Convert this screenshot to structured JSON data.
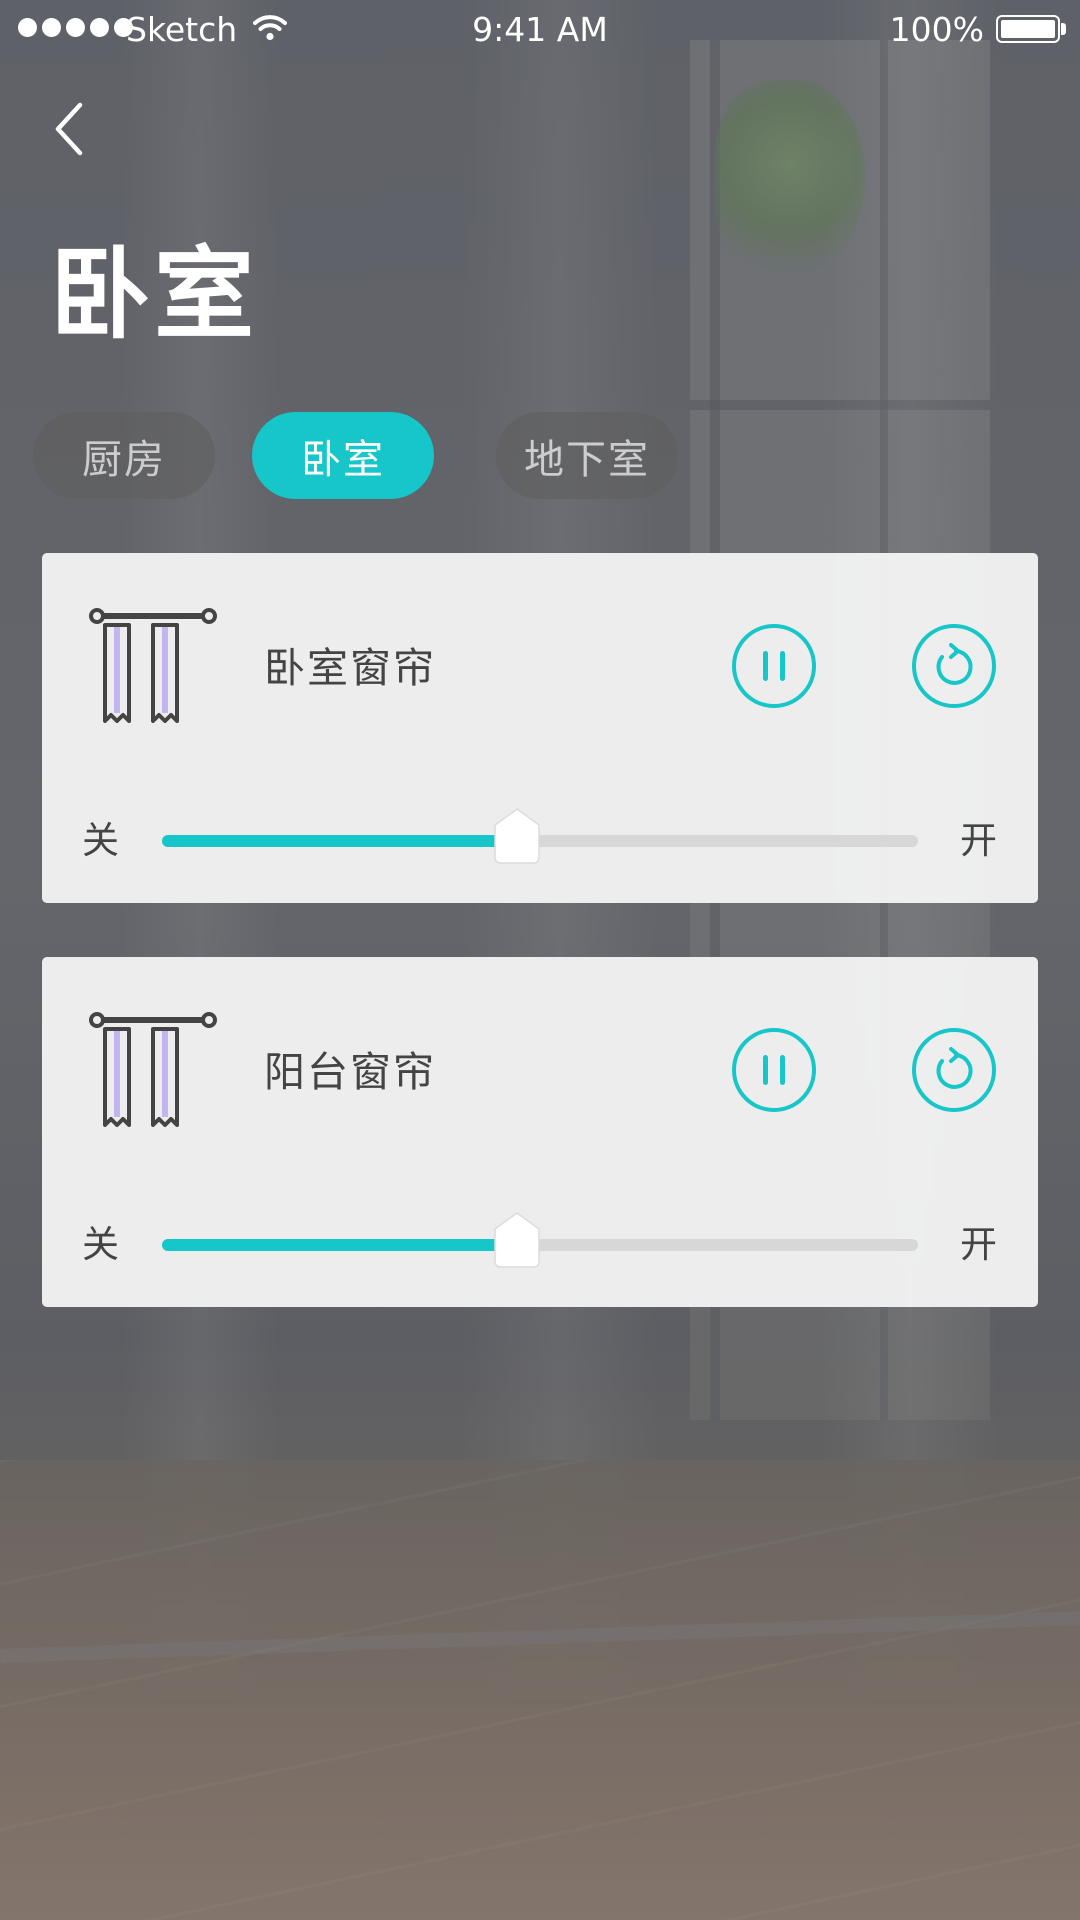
{
  "status_bar": {
    "carrier": "Sketch",
    "time": "9:41 AM",
    "battery": "100%"
  },
  "header": {
    "title": "卧室"
  },
  "tabs": [
    {
      "label": "厨房",
      "active": false
    },
    {
      "label": "卧室",
      "active": true
    },
    {
      "label": "地下室",
      "active": false
    }
  ],
  "devices": [
    {
      "name": "卧室窗帘",
      "icon": "curtain-icon",
      "slider_min": "关",
      "slider_max": "开",
      "level": 0.47
    },
    {
      "name": "阳台窗帘",
      "icon": "curtain-icon",
      "slider_min": "关",
      "slider_max": "开",
      "level": 0.47
    }
  ],
  "controls": {
    "pause_icon": "pause-icon",
    "refresh_icon": "refresh-icon"
  },
  "colors": {
    "accent": "#16c6c8",
    "card": "#f2f2f2",
    "text": "#444444",
    "curtain_fabric": "#c3b6ee"
  }
}
